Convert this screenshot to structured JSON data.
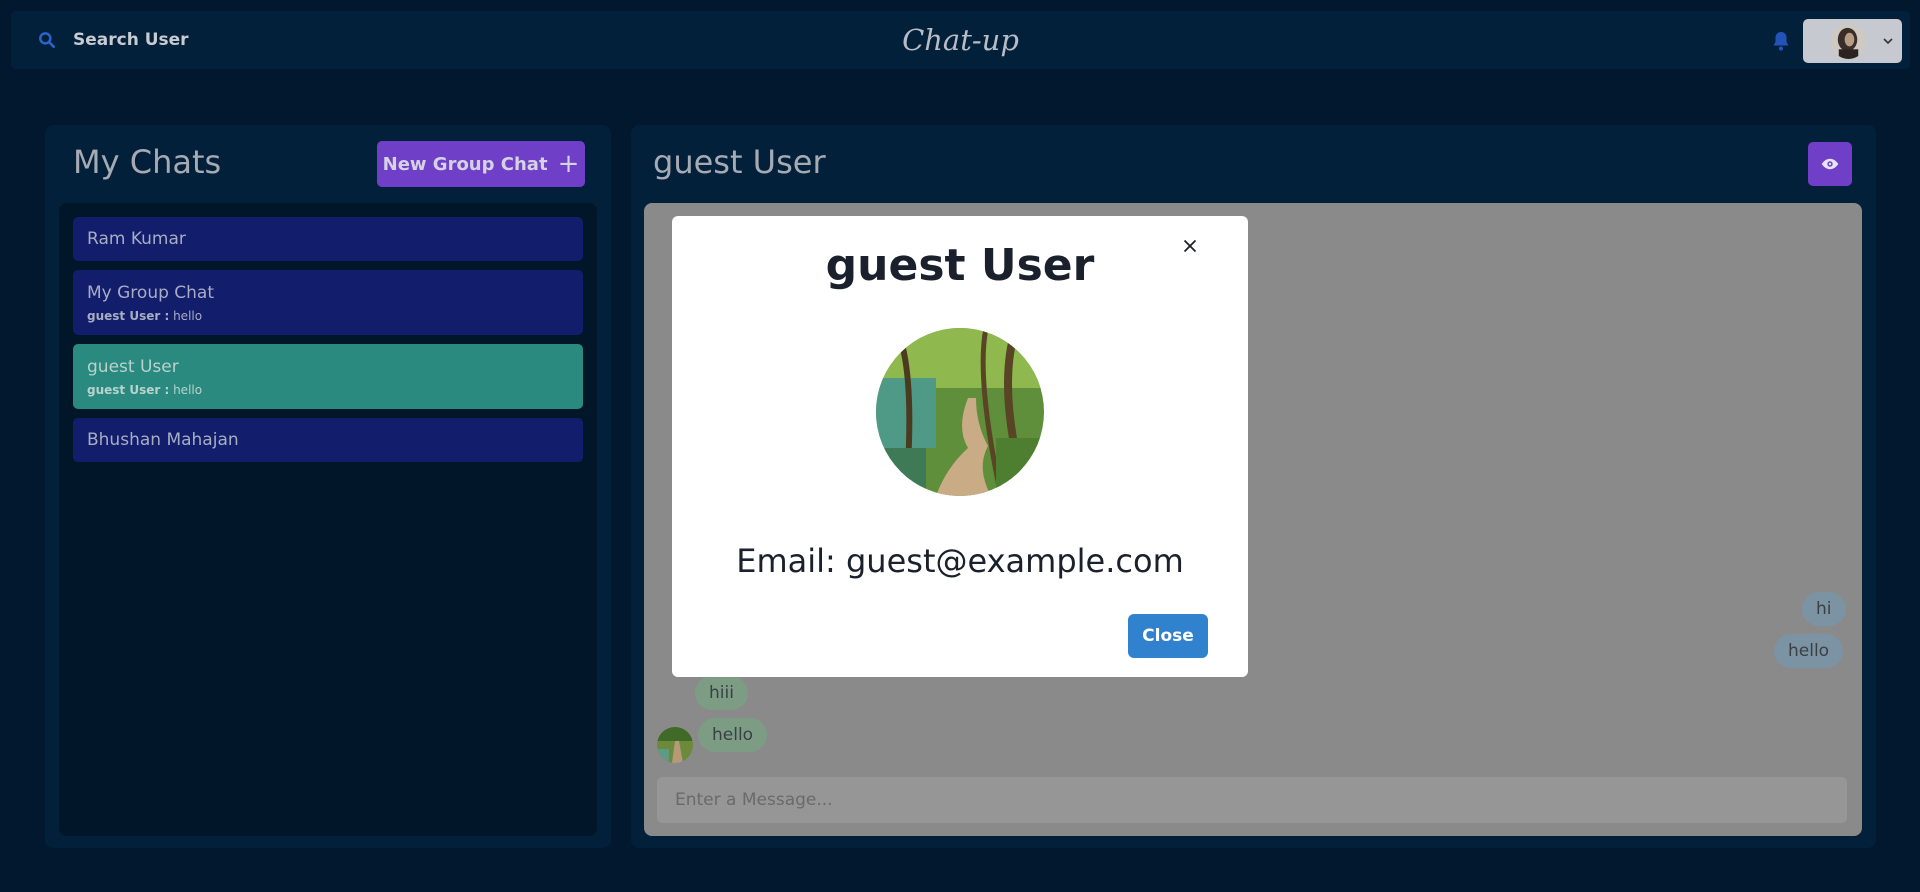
{
  "header": {
    "search_label": "Search User",
    "brand": "Chat-up",
    "icons": {
      "search": "search-icon",
      "bell": "bell-icon",
      "chevron": "chevron-down-icon"
    }
  },
  "sidebar": {
    "title": "My Chats",
    "new_group_label": "New Group Chat",
    "chats": [
      {
        "name": "Ram Kumar",
        "latest_sender": "",
        "latest_text": ""
      },
      {
        "name": "My Group Chat",
        "latest_sender": "guest User :",
        "latest_text": "hello"
      },
      {
        "name": "guest User",
        "latest_sender": "guest User :",
        "latest_text": "hello",
        "active": true
      },
      {
        "name": "Bhushan Mahajan",
        "latest_sender": "",
        "latest_text": ""
      }
    ]
  },
  "conversation": {
    "title": "guest User",
    "messages": [
      {
        "text": "hi",
        "mine": true
      },
      {
        "text": "hello",
        "mine": true
      },
      {
        "text": "hiii",
        "mine": false
      },
      {
        "text": "hello",
        "mine": false
      }
    ],
    "input_placeholder": "Enter a Message..."
  },
  "modal": {
    "title": "guest User",
    "email": "Email: guest@example.com",
    "close_label": "Close"
  },
  "colors": {
    "background": "#01182e",
    "panel": "#022039",
    "accent_purple": "#6f3fc7",
    "chat_item": "#121d6c",
    "chat_active": "#2a8a80",
    "modal_button": "#3182ce"
  }
}
